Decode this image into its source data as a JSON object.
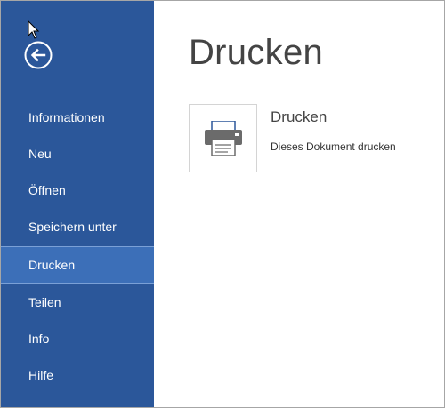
{
  "sidebar": {
    "back_icon": "back-arrow-icon",
    "items": [
      {
        "label": "Informationen",
        "selected": false
      },
      {
        "label": "Neu",
        "selected": false
      },
      {
        "label": "Öffnen",
        "selected": false
      },
      {
        "label": "Speichern unter",
        "selected": false
      },
      {
        "label": "Drucken",
        "selected": true
      },
      {
        "label": "Teilen",
        "selected": false
      },
      {
        "label": "Info",
        "selected": false
      },
      {
        "label": "Hilfe",
        "selected": false
      }
    ]
  },
  "main": {
    "title": "Drucken",
    "print_option": {
      "icon": "printer-icon",
      "name": "Drucken",
      "description": "Dieses Dokument drucken"
    }
  },
  "colors": {
    "sidebar_bg": "#2b579a",
    "selected_bg": "#3c6fb8",
    "title_text": "#444444"
  }
}
